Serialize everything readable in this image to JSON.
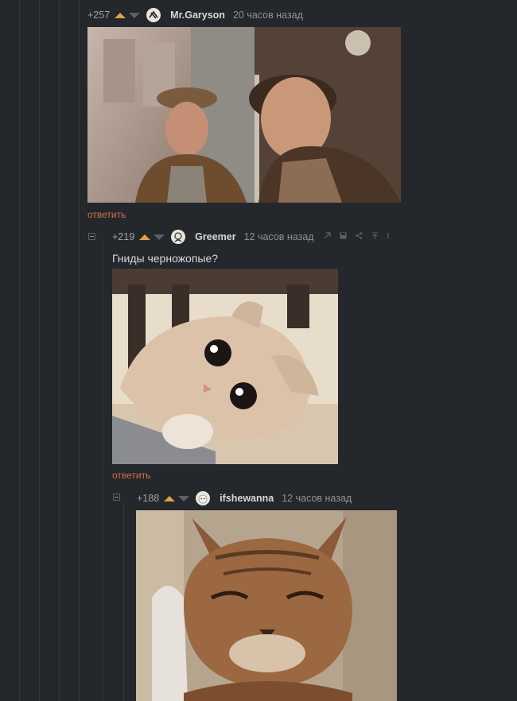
{
  "comments": [
    {
      "rating": "+257",
      "username": "Mr.Garyson",
      "time": "20 часов назад",
      "reply_label": "ответить",
      "image": "two-men-in-tram-photo"
    },
    {
      "rating": "+219",
      "username": "Greemer",
      "time": "12 часов назад",
      "text": "Гниды черножопые?",
      "reply_label": "ответить",
      "image": "wide-eyed-kitten-photo",
      "tools": [
        "link-icon",
        "save-icon",
        "share-icon",
        "upvote-parent-icon",
        "more-icon"
      ]
    },
    {
      "rating": "+188",
      "username": "ifshewanna",
      "time": "12 часов назад",
      "image": "smug-tabby-cat-photo"
    }
  ],
  "colors": {
    "background": "#24272b",
    "reply_link": "#d46e52",
    "upvote_active": "#d9a34a",
    "username": "#d6d9dc"
  }
}
